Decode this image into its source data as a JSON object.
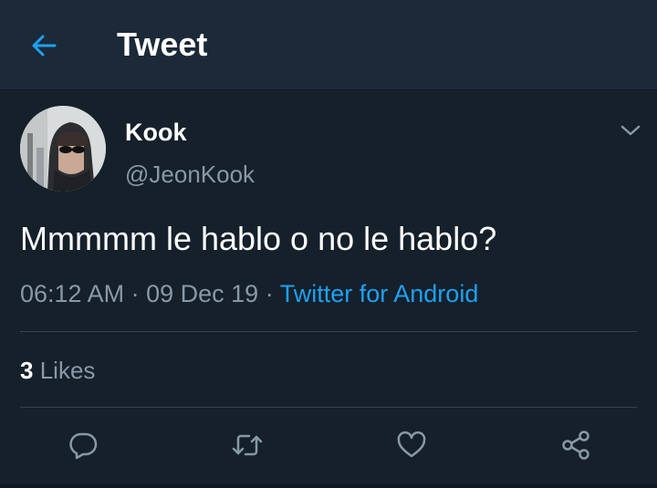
{
  "header": {
    "title": "Tweet",
    "back_icon": "arrow-left-icon",
    "accent": "#1da1f2"
  },
  "tweet": {
    "author_name": "Kook",
    "author_handle": "@JeonKook",
    "text": "Mmmmm le hablo o no le hablo?",
    "time": "06:12 AM",
    "date": "09 Dec 19",
    "source": "Twitter for Android",
    "separator": "·",
    "likes_count": "3",
    "likes_label": "Likes"
  },
  "actions": [
    "reply-icon",
    "retweet-icon",
    "like-icon",
    "share-icon"
  ],
  "colors": {
    "background": "#15202b",
    "header": "#1c2938",
    "muted": "#8899a6",
    "link": "#1da1f2"
  }
}
